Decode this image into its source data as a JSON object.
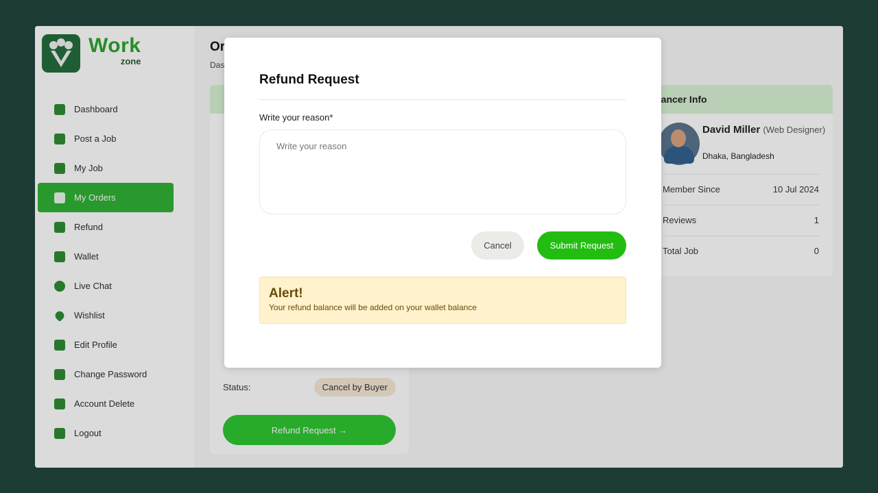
{
  "brand": {
    "name": "Work",
    "sub": "zone"
  },
  "sidebar": {
    "items": [
      {
        "label": "Dashboard",
        "icon": "home-icon"
      },
      {
        "label": "Post a Job",
        "icon": "post-job-icon"
      },
      {
        "label": "My Job",
        "icon": "briefcase-icon"
      },
      {
        "label": "My Orders",
        "icon": "orders-icon",
        "active": true
      },
      {
        "label": "Refund",
        "icon": "refund-icon"
      },
      {
        "label": "Wallet",
        "icon": "wallet-icon"
      },
      {
        "label": "Live Chat",
        "icon": "chat-icon"
      },
      {
        "label": "Wishlist",
        "icon": "heart-icon"
      },
      {
        "label": "Edit Profile",
        "icon": "profile-icon"
      },
      {
        "label": "Change Password",
        "icon": "lock-icon"
      },
      {
        "label": "Account Delete",
        "icon": "user-delete-icon"
      },
      {
        "label": "Logout",
        "icon": "logout-icon"
      }
    ]
  },
  "main": {
    "title": "Or",
    "breadcrumb": "Das",
    "order": {
      "status_label": "Status:",
      "status_value": "Cancel by Buyer",
      "refund_button": "Refund Request →"
    },
    "freelancer": {
      "header": "elancer Info",
      "name": "David Miller",
      "role": "(Web Designer)",
      "location": "Dhaka, Bangladesh",
      "rows": [
        {
          "label": "Member Since",
          "value": "10 Jul 2024"
        },
        {
          "label": "Reviews",
          "value": "1"
        },
        {
          "label": "Total Job",
          "value": "0"
        }
      ]
    }
  },
  "modal": {
    "title": "Refund Request",
    "field_label": "Write your reason*",
    "placeholder": "Write your reason",
    "cancel": "Cancel",
    "submit": "Submit Request",
    "alert_title": "Alert!",
    "alert_text": "Your refund balance will be added on your wallet balance"
  },
  "colors": {
    "accent": "#2bb130",
    "submit": "#23bd12",
    "alert_bg": "#fff2cc",
    "backdrop": "#1d3b35"
  }
}
